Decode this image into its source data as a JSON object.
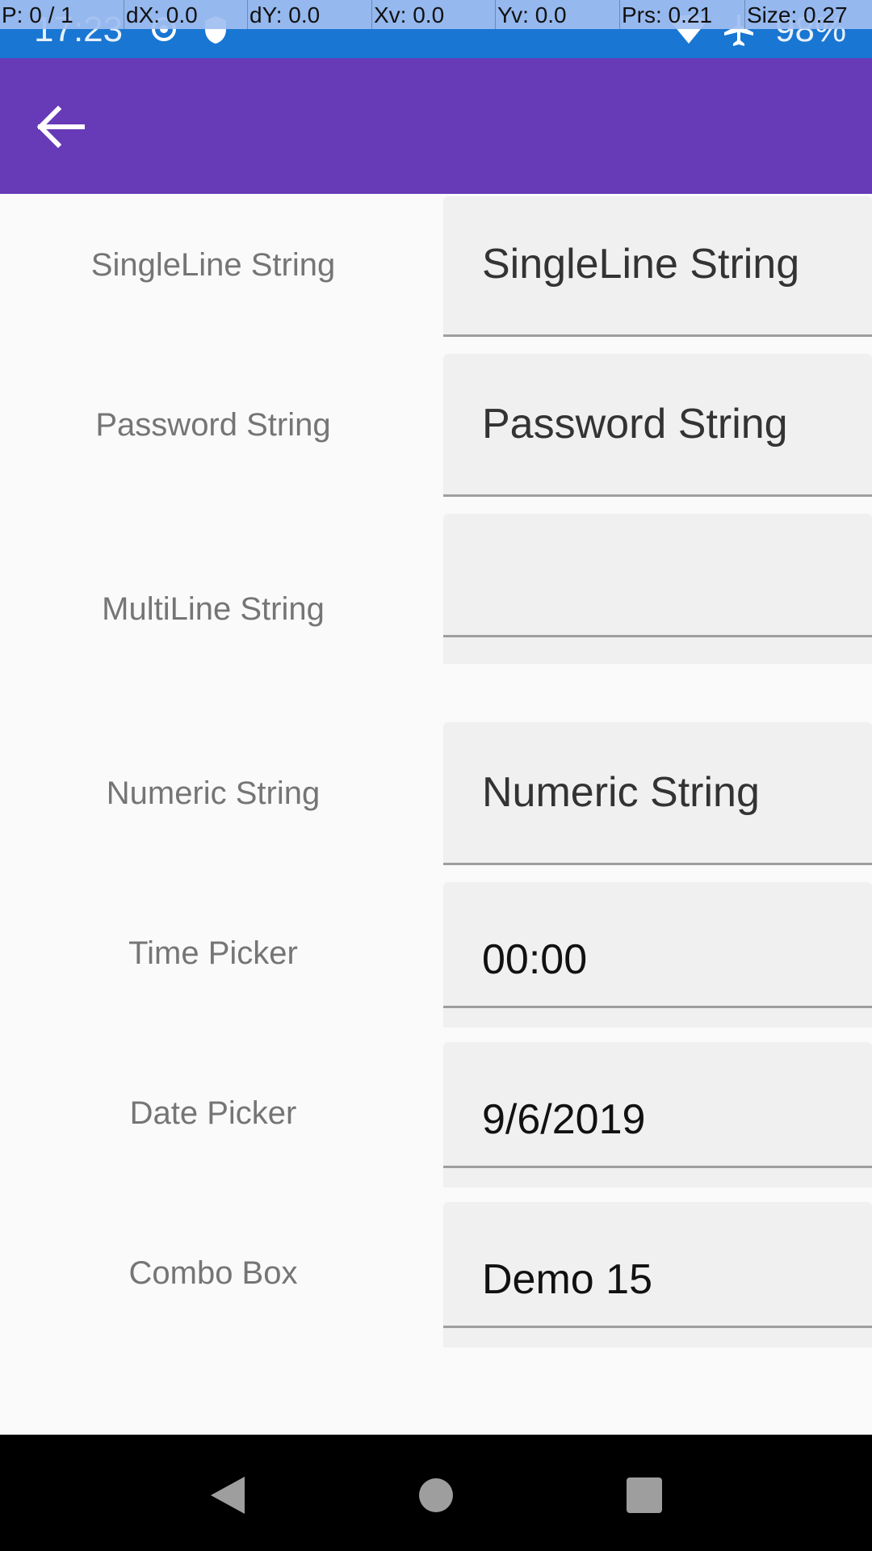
{
  "status_bar": {
    "time": "17:23",
    "battery": "98%",
    "icons": [
      "location-icon",
      "shield-icon",
      "wifi-icon",
      "airplane-icon"
    ]
  },
  "debug_overlay": {
    "pointer": "P: 0 / 1",
    "dx": "dX: 0.0",
    "dy": "dY: 0.0",
    "xv": "Xv: 0.0",
    "yv": "Yv: 0.0",
    "prs": "Prs: 0.21",
    "size": "Size: 0.27",
    "highlight_color": "#e53935"
  },
  "app_bar": {
    "color": "#673ab7",
    "back_icon": "arrow-back-icon"
  },
  "form": {
    "rows": [
      {
        "label": "SingleLine String",
        "placeholder": "SingleLine String",
        "value": ""
      },
      {
        "label": "Password String",
        "placeholder": "Password String",
        "value": ""
      },
      {
        "label": "MultiLine String",
        "placeholder": "",
        "value": ""
      },
      {
        "label": "Numeric String",
        "placeholder": "Numeric String",
        "value": ""
      },
      {
        "label": "Time Picker",
        "placeholder": "",
        "value": "00:00"
      },
      {
        "label": "Date Picker",
        "placeholder": "",
        "value": "9/6/2019"
      },
      {
        "label": "Combo Box",
        "placeholder": "",
        "value": "Demo 15"
      }
    ]
  },
  "nav_bar": {
    "icons": [
      "back-triangle-icon",
      "home-circle-icon",
      "recents-square-icon"
    ]
  }
}
